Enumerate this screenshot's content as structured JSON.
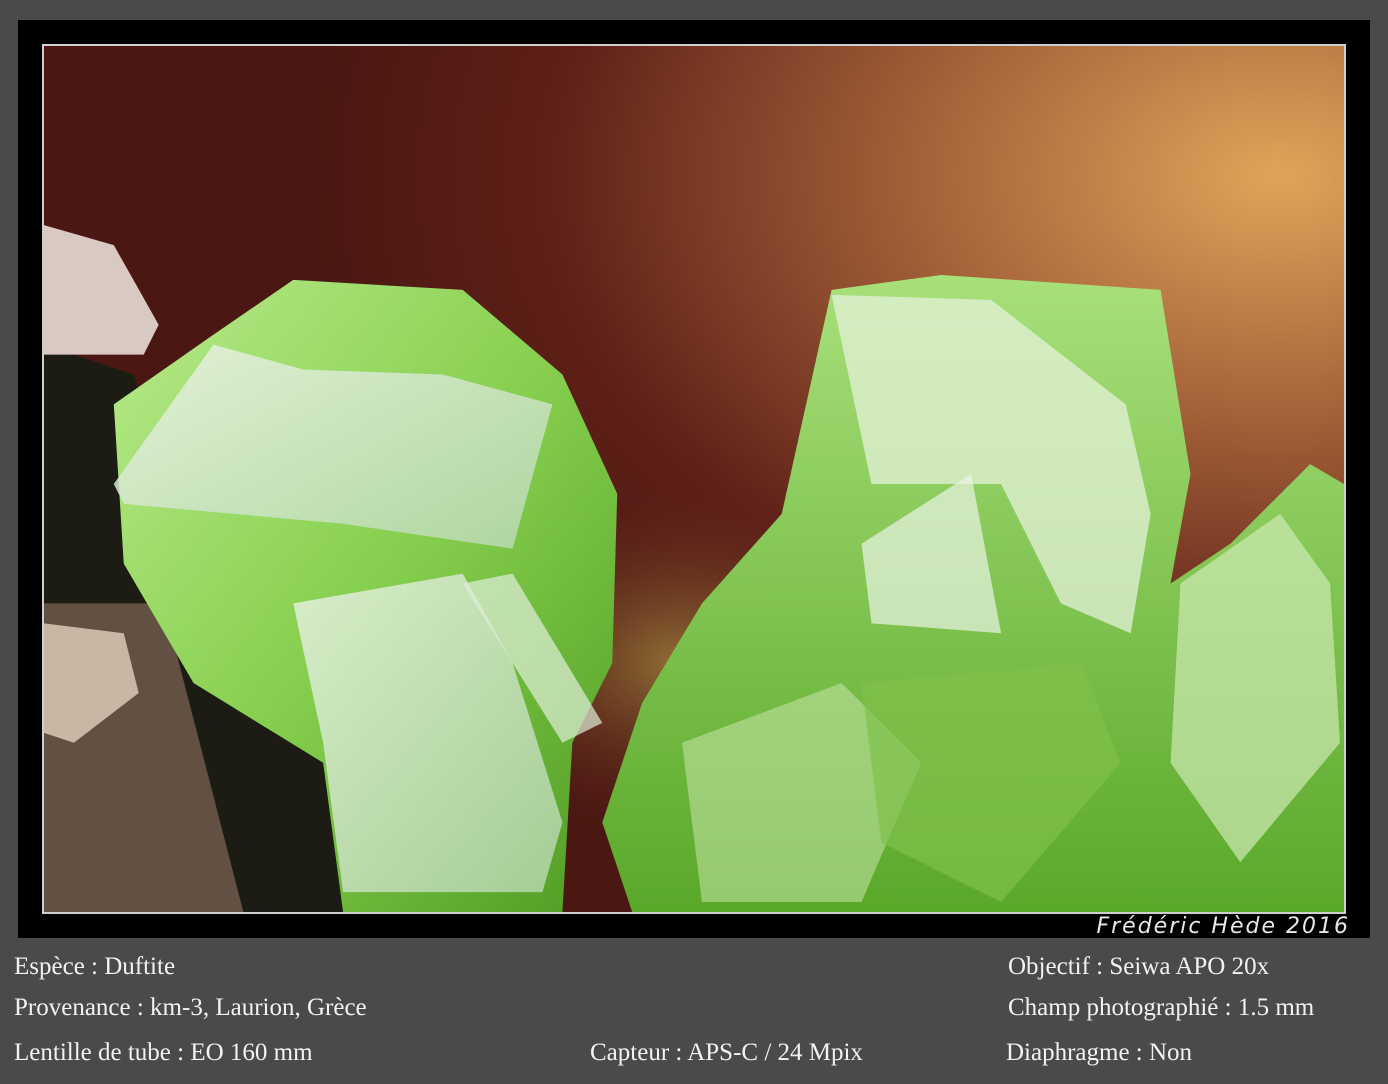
{
  "photo": {
    "subject": "duftite-crystals-photo",
    "signature": "Frédéric Hède 2016"
  },
  "caption": {
    "espece": "Espèce : Duftite",
    "provenance": "Provenance : km-3, Laurion, Grèce",
    "lentille": "Lentille de tube : EO 160 mm",
    "capteur": "Capteur : APS-C / 24 Mpix",
    "objectif": "Objectif : Seiwa APO 20x",
    "champ": "Champ photographié : 1.5 mm",
    "diaphragme": "Diaphragme : Non"
  },
  "colors": {
    "background": "#4a4a4a",
    "crystal_green": "#8fd45a",
    "matrix_brown": "#5a1e18",
    "glow_orange": "#d8a55a"
  }
}
